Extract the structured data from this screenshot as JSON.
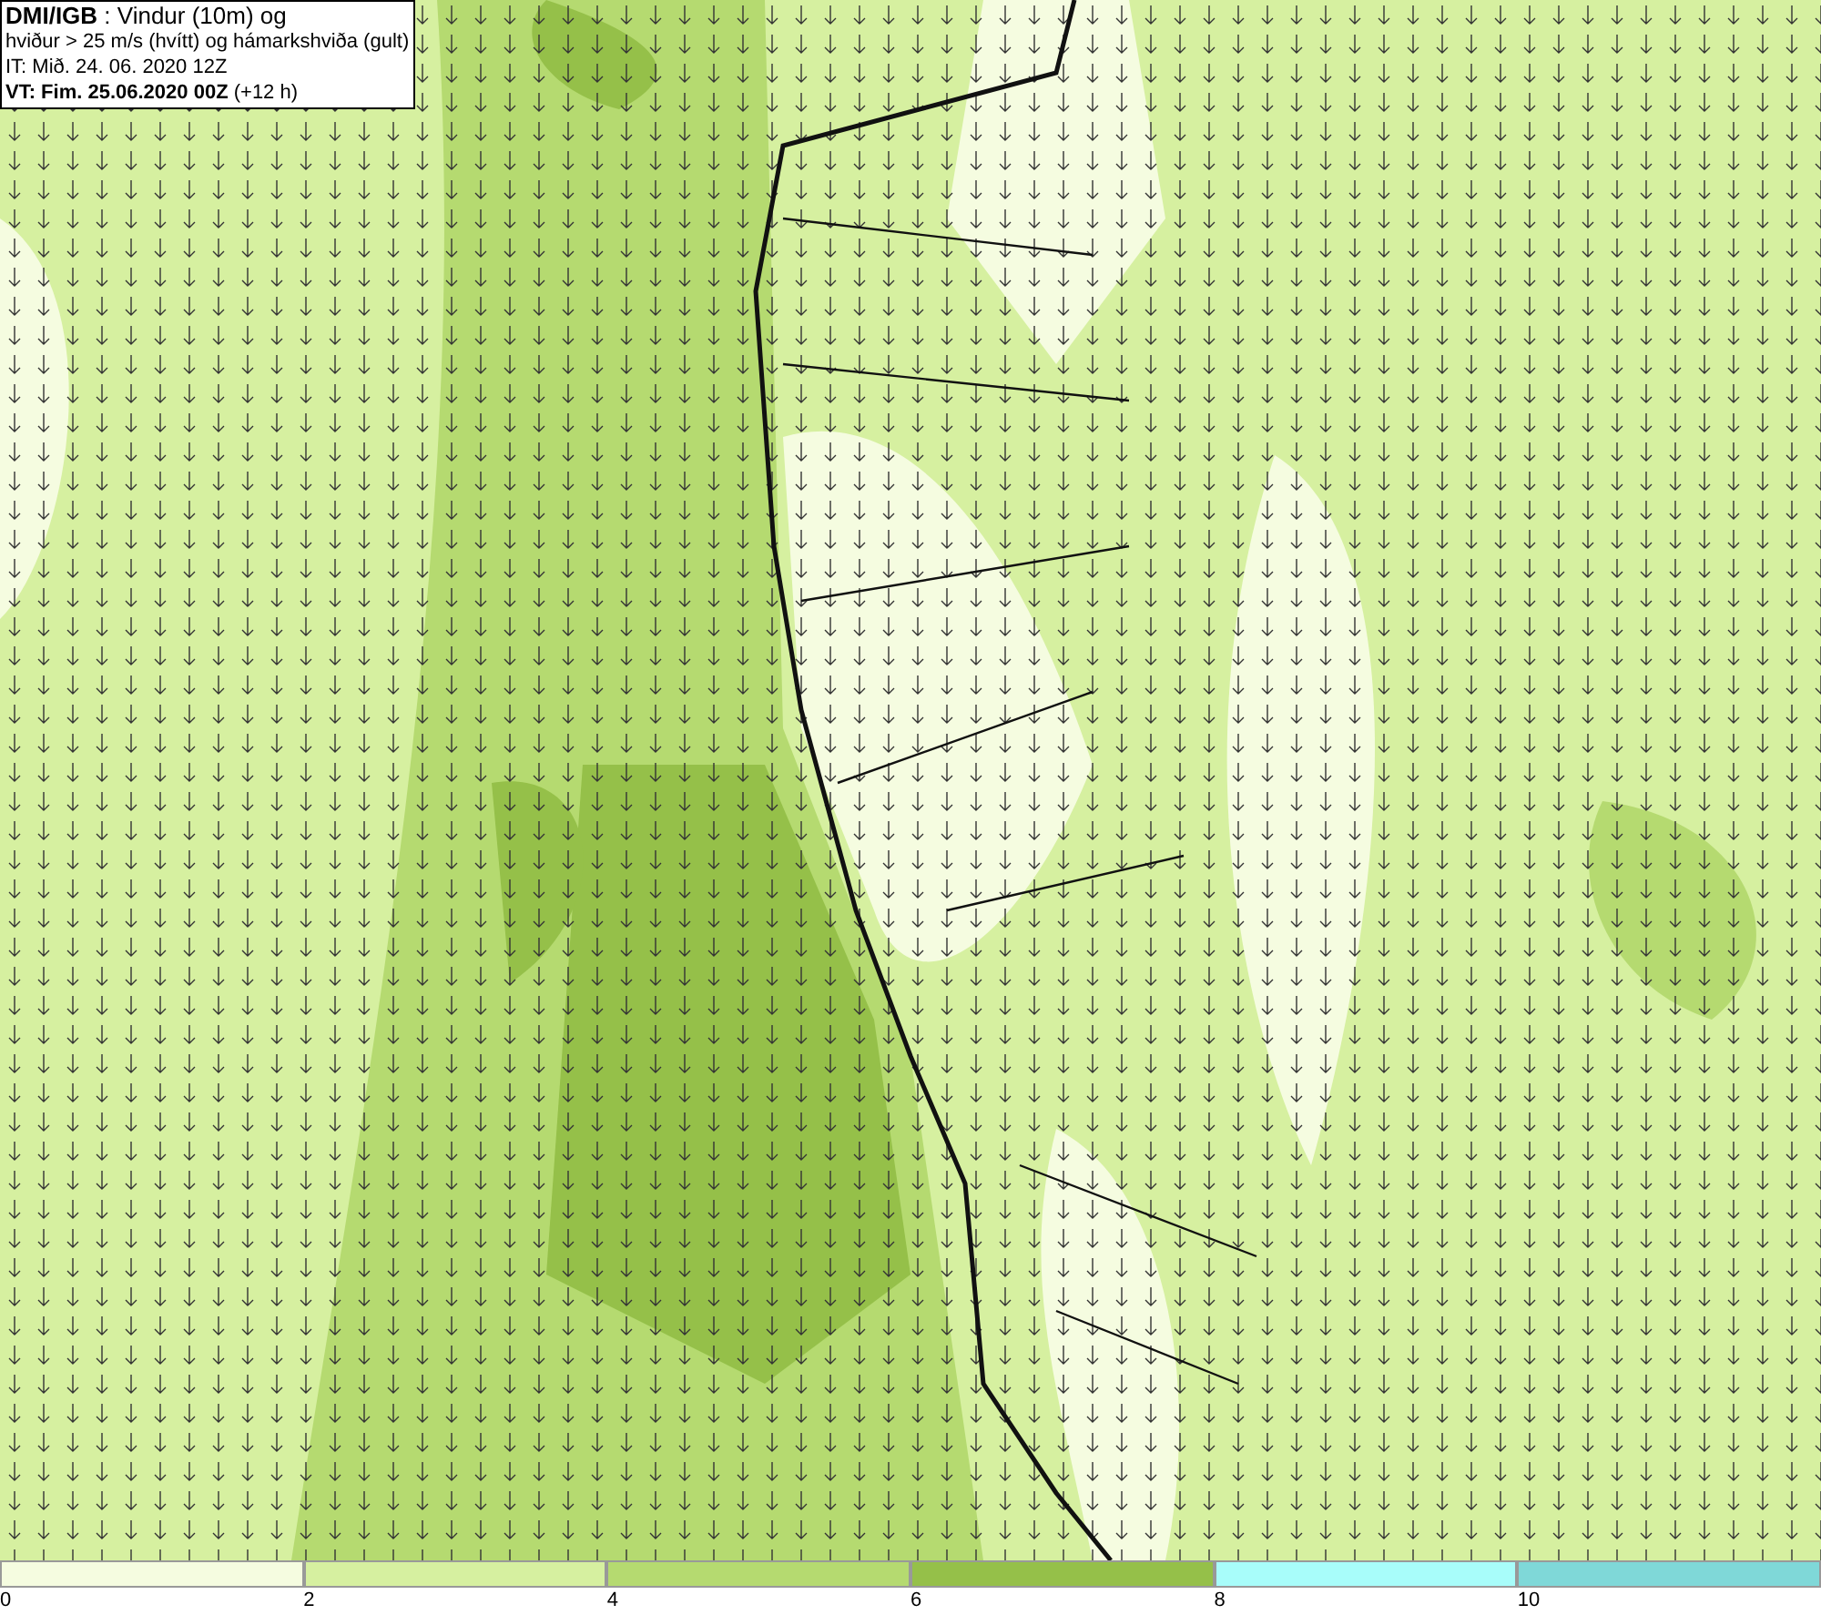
{
  "title_box": {
    "lines": [
      "**DMI/IGB** : Vindur (10m) og",
      "hviður > 25 m/s (hvítt) og hámarkshviða (gult)",
      "IT: Mið. 24. 06. 2020 12Z",
      "**VT: Fim. 25.06.2020 00Z** (+12 h)"
    ]
  },
  "legend": [
    {
      "label": "0",
      "color": "#f5fce0"
    },
    {
      "label": "2",
      "color": "#d6f0a0"
    },
    {
      "label": "4",
      "color": "#b5da70"
    },
    {
      "label": "6",
      "color": "#95c049"
    },
    {
      "label": "8",
      "color": "#a8fdfa"
    },
    {
      "label": "10",
      "color": "#7fd8d8"
    }
  ]
}
